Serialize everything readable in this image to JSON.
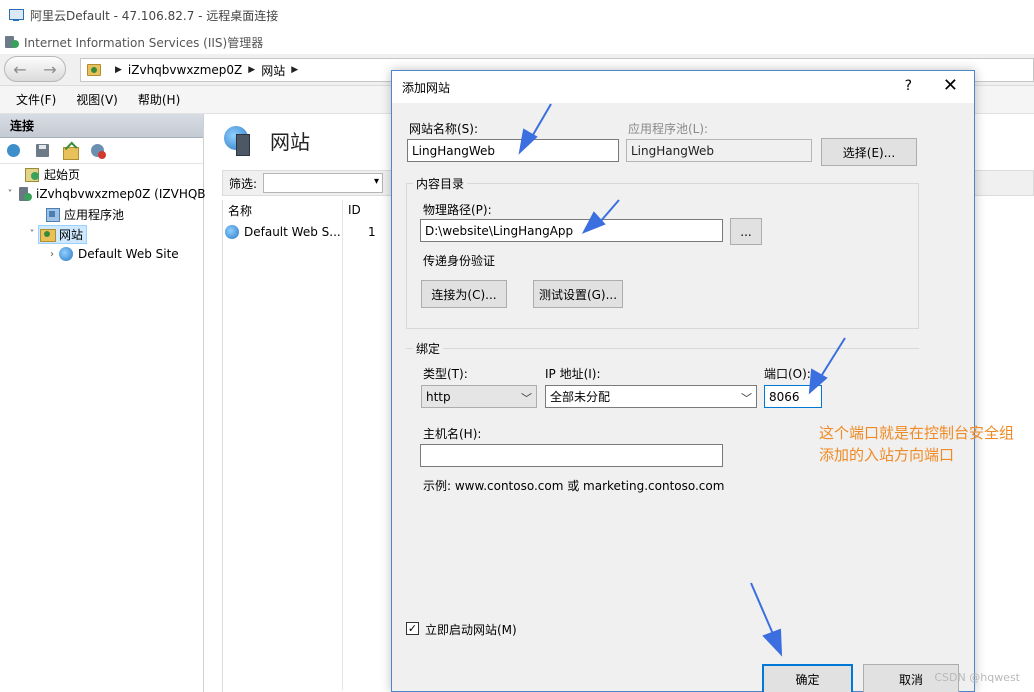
{
  "rdp": {
    "title": "阿里云Default - 47.106.82.7 - 远程桌面连接"
  },
  "iis": {
    "title": "Internet Information Services (IIS)管理器"
  },
  "address": {
    "crumb1": "iZvhqbvwxzmep0Z",
    "crumb2": "网站"
  },
  "menu": {
    "file": "文件(F)",
    "view": "视图(V)",
    "help": "帮助(H)"
  },
  "connections": {
    "header": "连接",
    "tree": {
      "start_page": "起始页",
      "server": "iZvhqbvwxzmep0Z (IZVHQB",
      "app_pools": "应用程序池",
      "sites": "网站",
      "default_site": "Default Web Site"
    }
  },
  "center": {
    "title": "网站",
    "filter_label": "筛选:",
    "columns": {
      "name": "名称",
      "id": "ID"
    },
    "rows": [
      {
        "name": "Default Web S...",
        "id": "1"
      }
    ]
  },
  "dialog": {
    "title": "添加网站",
    "help": "?",
    "close": "✕",
    "site_name_label": "网站名称(S):",
    "site_name_value": "LingHangWeb",
    "app_pool_label": "应用程序池(L):",
    "app_pool_value": "LingHangWeb",
    "select_button": "选择(E)...",
    "content_group": "内容目录",
    "physical_path_label": "物理路径(P):",
    "physical_path_value": "D:\\website\\LingHangApp",
    "browse_button": "...",
    "passthrough_label": "传递身份验证",
    "connect_as_button": "连接为(C)...",
    "test_settings_button": "测试设置(G)...",
    "binding_group": "绑定",
    "type_label": "类型(T):",
    "type_value": "http",
    "ip_label": "IP 地址(I):",
    "ip_value": "全部未分配",
    "port_label": "端口(O):",
    "port_value": "8066",
    "hostname_label": "主机名(H):",
    "hostname_value": "",
    "example_text": "示例: www.contoso.com 或 marketing.contoso.com",
    "start_now_label": "立即启动网站(M)",
    "start_now_checked": true,
    "ok_button": "确定",
    "cancel_button": "取消"
  },
  "annotation": {
    "line1": "这个端口就是在控制台安全组",
    "line2": "添加的入站方向端口",
    "color": "#f08a24"
  },
  "watermark": "CSDN @hqwest",
  "colors": {
    "accent": "#0078d7",
    "arrow": "#3b6fe0"
  }
}
